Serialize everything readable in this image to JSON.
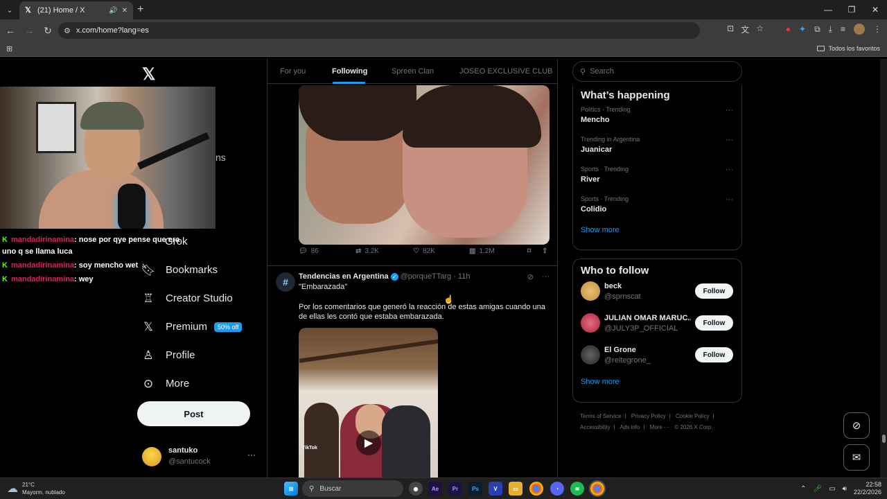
{
  "browser": {
    "tab_title": "(21) Home / X",
    "url": "x.com/home?lang=es",
    "bookmarks_folder": "Todos los favoritos"
  },
  "overlay": {
    "chat": [
      {
        "user": "mandadirinamina",
        "text": ": nose por qye pense que era uno q se llama luca"
      },
      {
        "user": "mandadirinamina",
        "text": ": soy mencho wet"
      },
      {
        "user": "mandadirinamina",
        "text": ": wey"
      }
    ],
    "fragment": "ns"
  },
  "sidebar": {
    "grok_label": "Grok",
    "items": [
      {
        "label": "Bookmarks",
        "icon": "bookmark-icon"
      },
      {
        "label": "Creator Studio",
        "icon": "creator-studio-icon"
      },
      {
        "label": "Premium",
        "icon": "x-logo-icon",
        "badge": "50% off"
      },
      {
        "label": "Profile",
        "icon": "person-icon"
      },
      {
        "label": "More",
        "icon": "more-circle-icon"
      }
    ],
    "post_button": "Post",
    "account": {
      "name": "santuko",
      "handle": "@santucock"
    }
  },
  "timeline": {
    "tabs": [
      "For you",
      "Following",
      "Spreen Clan",
      "JOSEO EXCLUSIVE CLUB"
    ],
    "active_tab": "Following",
    "post1_actions": {
      "replies": "86",
      "reposts": "3.2K",
      "likes": "82K",
      "views": "1.2M"
    },
    "post2": {
      "author": "Tendencias en Argentina",
      "handle": "@porqueTTarg",
      "time": "· 11h",
      "subtitle": "\"Embarazada\"",
      "body": "Por los comentarios que generó la reacción de estas amigas cuando una de ellas les contó que estaba embarazada.",
      "watermark": "TikTok"
    }
  },
  "right": {
    "search_placeholder": "Search",
    "happening_title": "What’s happening",
    "trends": [
      {
        "context": "Politics · Trending",
        "name": "Mencho"
      },
      {
        "context": "Trending in Argentina",
        "name": "Juanicar"
      },
      {
        "context": "Sports · Trending",
        "name": "River"
      },
      {
        "context": "Sports · Trending",
        "name": "Colidio"
      }
    ],
    "show_more": "Show more",
    "who_to_follow_title": "Who to follow",
    "follow_label": "Follow",
    "who_to_follow": [
      {
        "name": "beck",
        "handle": "@sprnscat"
      },
      {
        "name": "JULIAN OMAR MARUC...",
        "handle": "@JULY3P_OFFICIAL"
      },
      {
        "name": "El Grone",
        "handle": "@reitegrone_"
      }
    ],
    "footer": [
      "Terms of Service",
      "|",
      "Privacy Policy",
      "|",
      "Cookie Policy",
      "|",
      "Accessibility",
      "|",
      "Ads info",
      "|",
      "More ···",
      "© 2026 X Corp."
    ]
  },
  "taskbar": {
    "temp": "21°C",
    "weather": "Mayorm. nublado",
    "search": "Buscar",
    "time": "22:58",
    "date": "22/2/2026"
  }
}
